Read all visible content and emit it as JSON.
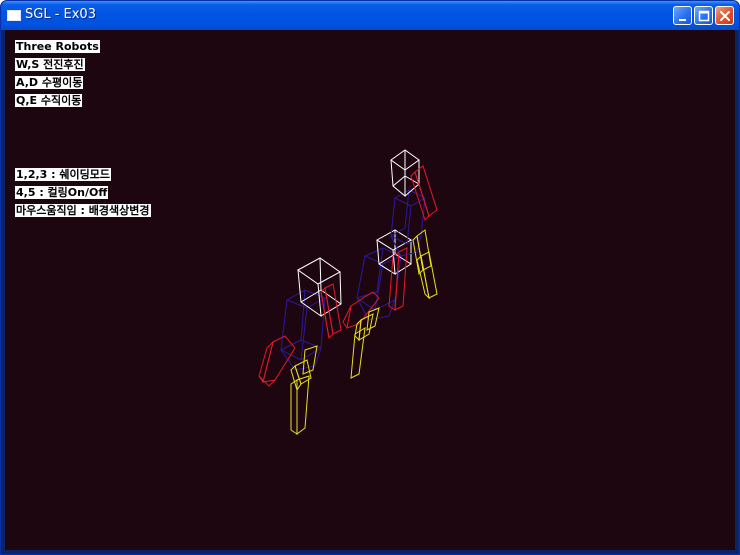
{
  "window": {
    "title": "SGL - Ex03",
    "controls": [
      "minimize-icon",
      "maximize-icon",
      "close-icon"
    ]
  },
  "overlay": {
    "lines": [
      "Three Robots",
      "W,S 전진후진",
      "A,D 수평이동",
      "Q,E 수직이동",
      "1,2,3 : 쉐이딩모드",
      "4,5 : 컬링On/Off",
      "마우스움직임 : 배경색상변경"
    ]
  },
  "scene": {
    "background_color": "#1e0610",
    "robot_count": 3,
    "colors": {
      "head": "#ffffff",
      "body": "#2a1a9c",
      "arm": "#e01a2a",
      "leg": "#e6e020"
    }
  }
}
